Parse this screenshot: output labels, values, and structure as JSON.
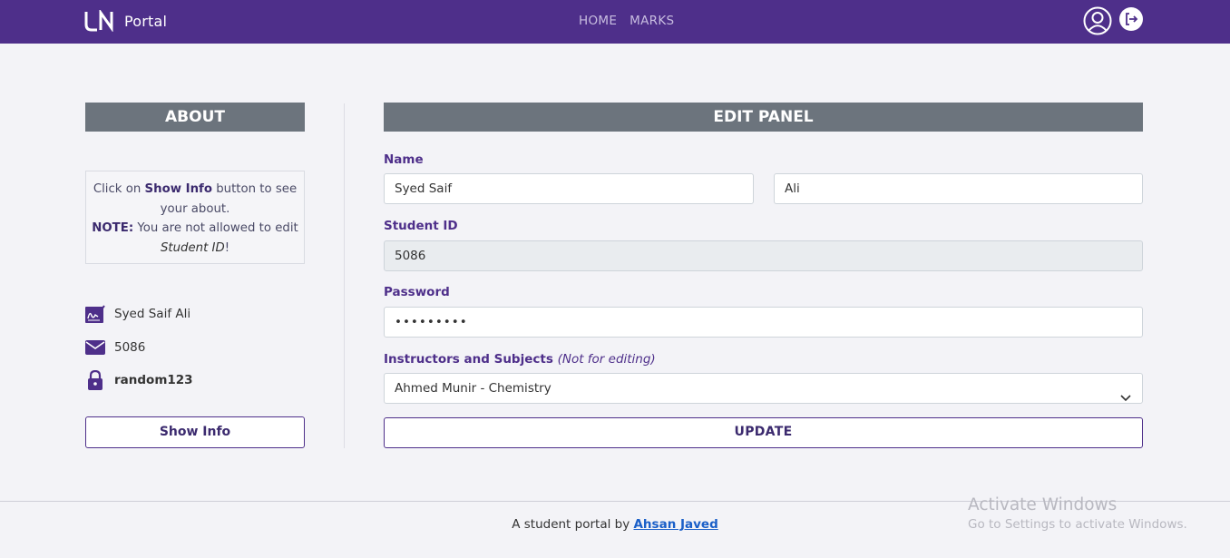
{
  "nav": {
    "brand_text": "Portal",
    "links": [
      "HOME",
      "MARKS"
    ],
    "icons": [
      "user-circle-icon",
      "logout-icon"
    ]
  },
  "about": {
    "header": "ABOUT",
    "info_line1_pre": "Click on ",
    "info_line1_bold": "Show Info",
    "info_line1_post": " button to see your about.",
    "info_note_bold": "NOTE:",
    "info_note_text": " You are not allowed to edit ",
    "info_note_italic": "Student ID",
    "info_note_end": "!",
    "name": "Syed Saif Ali",
    "student_id": "5086",
    "password": "random123",
    "show_info_label": "Show Info"
  },
  "edit": {
    "header": "EDIT PANEL",
    "name_label": "Name",
    "first_name": "Syed Saif",
    "last_name": "Ali",
    "student_id_label": "Student ID",
    "student_id_value": "5086",
    "password_label": "Password",
    "password_value": "•••••••••",
    "instructors_label": "Instructors and Subjects",
    "instructors_note": "(Not for editing)",
    "instructor_selected": "Ahmed Munir - Chemistry",
    "update_label": "UPDATE"
  },
  "footer": {
    "text": "A student portal by ",
    "author": "Ahsan Javed"
  },
  "watermark": {
    "title": "Activate Windows",
    "subtitle": "Go to Settings to activate Windows."
  },
  "colors": {
    "navbar": "#4e2f8a",
    "header_bg": "#6c747d",
    "accent": "#4e2f8a",
    "page_bg": "#f3f3f7"
  }
}
